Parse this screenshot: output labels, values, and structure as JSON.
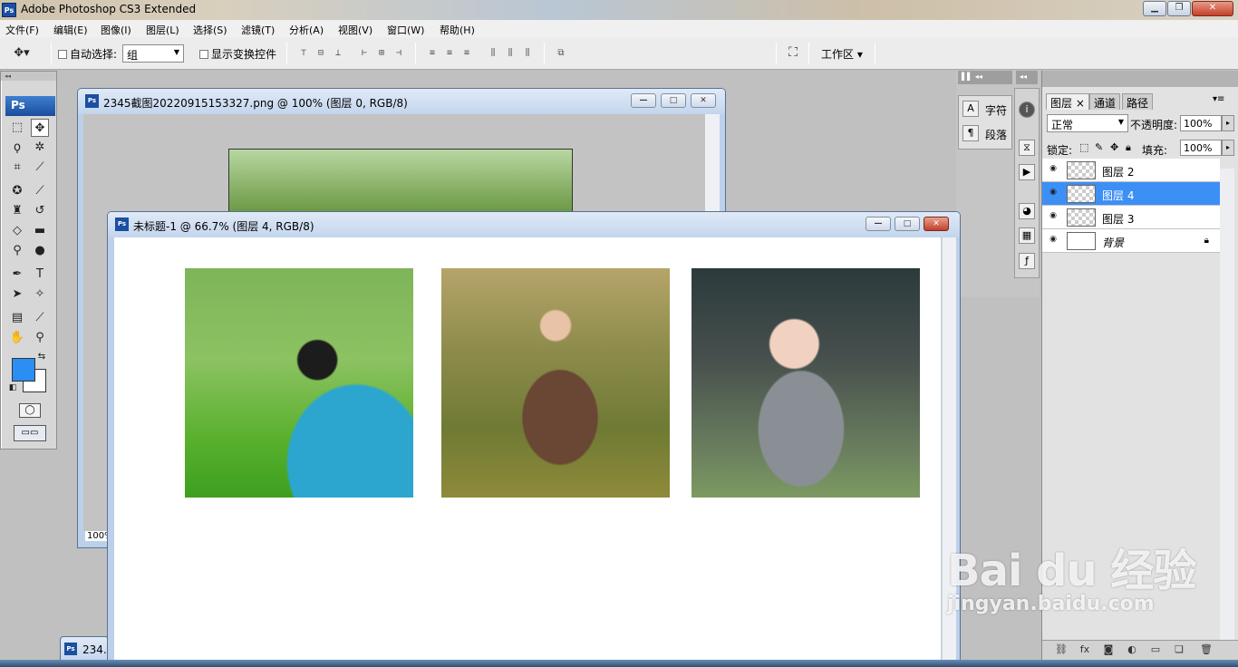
{
  "app": {
    "icon": "Ps",
    "title": "Adobe Photoshop CS3 Extended"
  },
  "menu": [
    "文件(F)",
    "编辑(E)",
    "图像(I)",
    "图层(L)",
    "选择(S)",
    "滤镜(T)",
    "分析(A)",
    "视图(V)",
    "窗口(W)",
    "帮助(H)"
  ],
  "options": {
    "auto_select_label": "自动选择:",
    "auto_select_value": "组",
    "show_transform_label": "显示变换控件",
    "workspace_label": "工作区"
  },
  "toolbox": {
    "badge": "Ps",
    "fg_color": "#2A8EF2",
    "bg_color": "#FFFFFF"
  },
  "doc1": {
    "title": "2345截图20220915153327.png @ 100% (图层 0, RGB/8)",
    "zoom": "100%"
  },
  "doc2": {
    "title": "未标题-1 @ 66.7% (图层 4, RGB/8)"
  },
  "minimized_doc": {
    "label": "234..."
  },
  "character_panel": {
    "char_label": "字符",
    "para_label": "段落"
  },
  "layers_panel": {
    "tabs": [
      "图层",
      "通道",
      "路径"
    ],
    "blend_mode": "正常",
    "opacity_label": "不透明度:",
    "opacity_value": "100%",
    "lock_label": "锁定:",
    "fill_label": "填充:",
    "fill_value": "100%",
    "layers": [
      {
        "name": "图层 2",
        "selected": false
      },
      {
        "name": "图层 4",
        "selected": true
      },
      {
        "name": "图层 3",
        "selected": false
      },
      {
        "name": "背景",
        "selected": false
      }
    ]
  },
  "watermark": {
    "brand": "Bai du 经验",
    "url": "jingyan.baidu.com"
  }
}
